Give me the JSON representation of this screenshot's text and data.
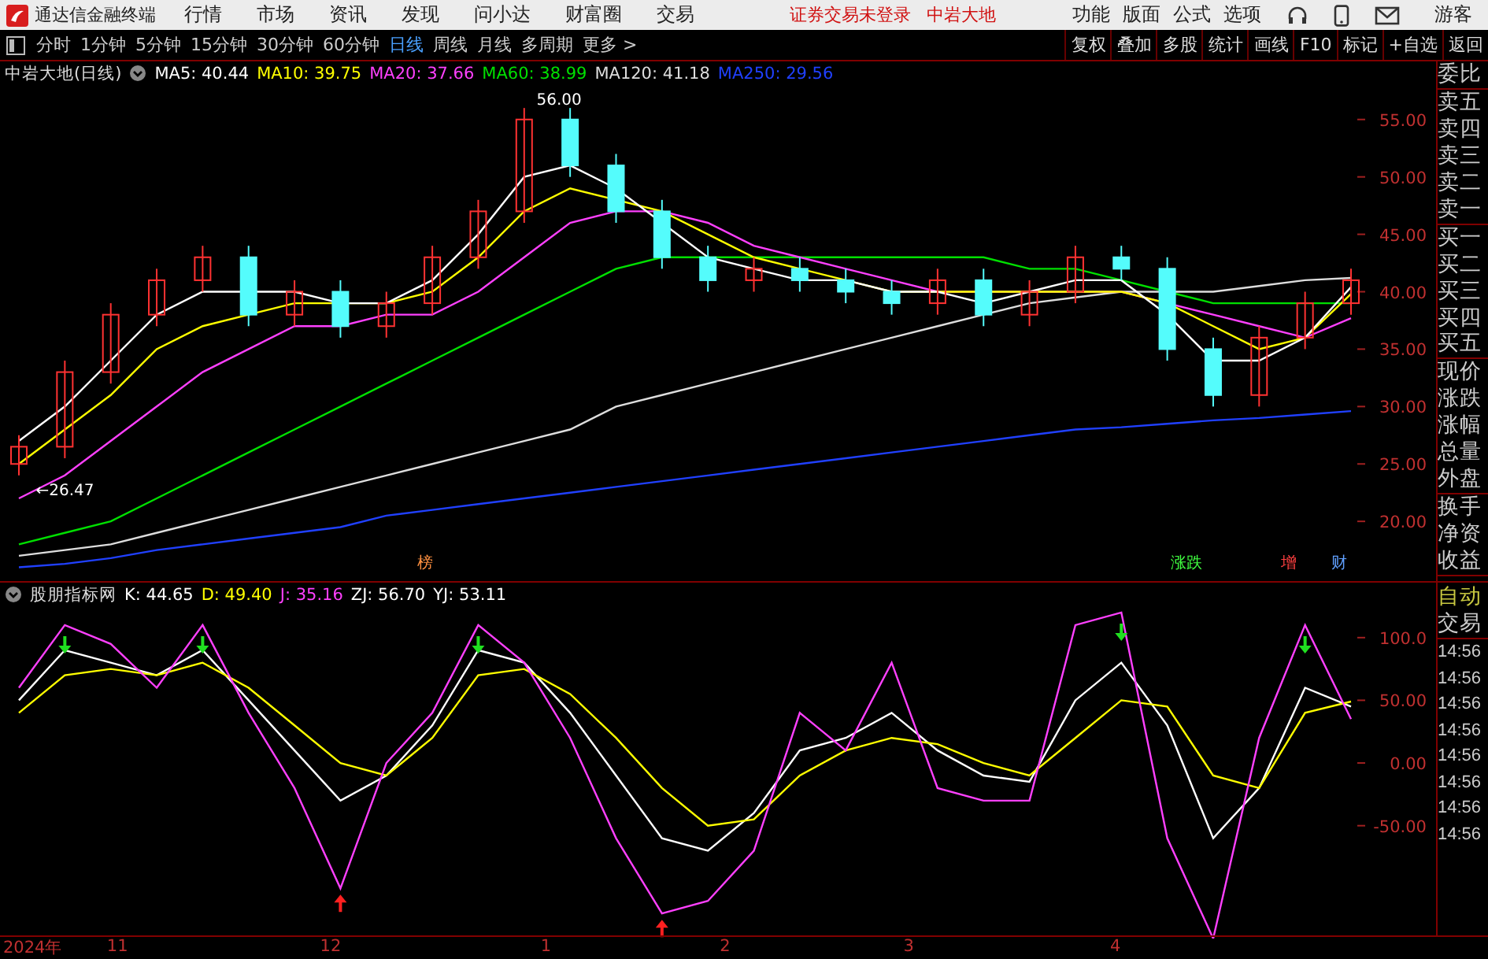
{
  "window": {
    "title": "通达信金融终端"
  },
  "menu": [
    {
      "label": "行情"
    },
    {
      "label": "市场"
    },
    {
      "label": "资讯"
    },
    {
      "label": "发现"
    },
    {
      "label": "问小达"
    },
    {
      "label": "财富圈"
    },
    {
      "label": "交易"
    }
  ],
  "notice": [
    "证券交易未登录",
    "中岩大地"
  ],
  "right_menu": [
    {
      "label": "功能"
    },
    {
      "label": "版面"
    },
    {
      "label": "公式"
    },
    {
      "label": "选项"
    }
  ],
  "user": "游客",
  "periods": [
    {
      "label": "分时",
      "selected": false
    },
    {
      "label": "1分钟",
      "selected": false
    },
    {
      "label": "5分钟",
      "selected": false
    },
    {
      "label": "15分钟",
      "selected": false
    },
    {
      "label": "30分钟",
      "selected": false
    },
    {
      "label": "60分钟",
      "selected": false
    },
    {
      "label": "日线",
      "selected": true
    },
    {
      "label": "周线",
      "selected": false
    },
    {
      "label": "月线",
      "selected": false
    },
    {
      "label": "多周期",
      "selected": false
    },
    {
      "label": "更多 >",
      "selected": false
    }
  ],
  "tools": [
    "复权",
    "叠加",
    "多股",
    "统计",
    "画线",
    "F10",
    "标记",
    "+自选",
    "返回"
  ],
  "main_chart": {
    "title": "中岩大地(日线)",
    "legend": [
      {
        "label": "MA5: 40.44",
        "color": "#ffffff"
      },
      {
        "label": "MA10: 39.75",
        "color": "#ffff00"
      },
      {
        "label": "MA20: 37.66",
        "color": "#ff40ff"
      },
      {
        "label": "MA60: 38.99",
        "color": "#00e000"
      },
      {
        "label": "MA120: 41.18",
        "color": "#dddddd"
      },
      {
        "label": "MA250: 29.56",
        "color": "#2040ff"
      }
    ],
    "axis_labels": [
      "55.00",
      "50.00",
      "45.00",
      "40.00",
      "35.00",
      "30.00",
      "25.00",
      "20.00"
    ],
    "markers": [
      {
        "text": "56.00",
        "color": "#ffffff"
      },
      {
        "text": "←26.47",
        "color": "#ffffff"
      },
      {
        "text": "榜",
        "color": "#ff9040"
      },
      {
        "text": "涨跌",
        "color": "#40ff40"
      },
      {
        "text": "增",
        "color": "#ff4040"
      },
      {
        "text": "财",
        "color": "#60a0ff"
      }
    ]
  },
  "indicator": {
    "title": "股朋指标网",
    "legend": [
      {
        "label": "K: 44.65",
        "color": "#ffffff"
      },
      {
        "label": "D: 49.40",
        "color": "#ffff00"
      },
      {
        "label": "J: 35.16",
        "color": "#ff40ff"
      },
      {
        "label": "ZJ: 56.70",
        "color": "#ffffff"
      },
      {
        "label": "YJ: 53.11",
        "color": "#ffffff"
      }
    ],
    "axis_labels": [
      "100.0",
      "50.00",
      "0.00",
      "-50.00"
    ]
  },
  "dates": [
    "2024年",
    "11",
    "12",
    "1",
    "2",
    "3",
    "4"
  ],
  "side_panel": {
    "groups": [
      [
        "委比"
      ],
      [
        "卖五",
        "卖四",
        "卖三",
        "卖二",
        "卖一"
      ],
      [
        "买一",
        "买二",
        "买三",
        "买四",
        "买五"
      ],
      [
        "现价",
        "涨跌",
        "涨幅",
        "总量",
        "外盘"
      ],
      [
        "换手",
        "净资",
        "收益"
      ]
    ],
    "status": "自动",
    "trade_label": "交易",
    "times": [
      "14:56",
      "14:56",
      "14:56",
      "14:56",
      "14:56",
      "14:56",
      "14:56",
      "14:56"
    ]
  }
}
